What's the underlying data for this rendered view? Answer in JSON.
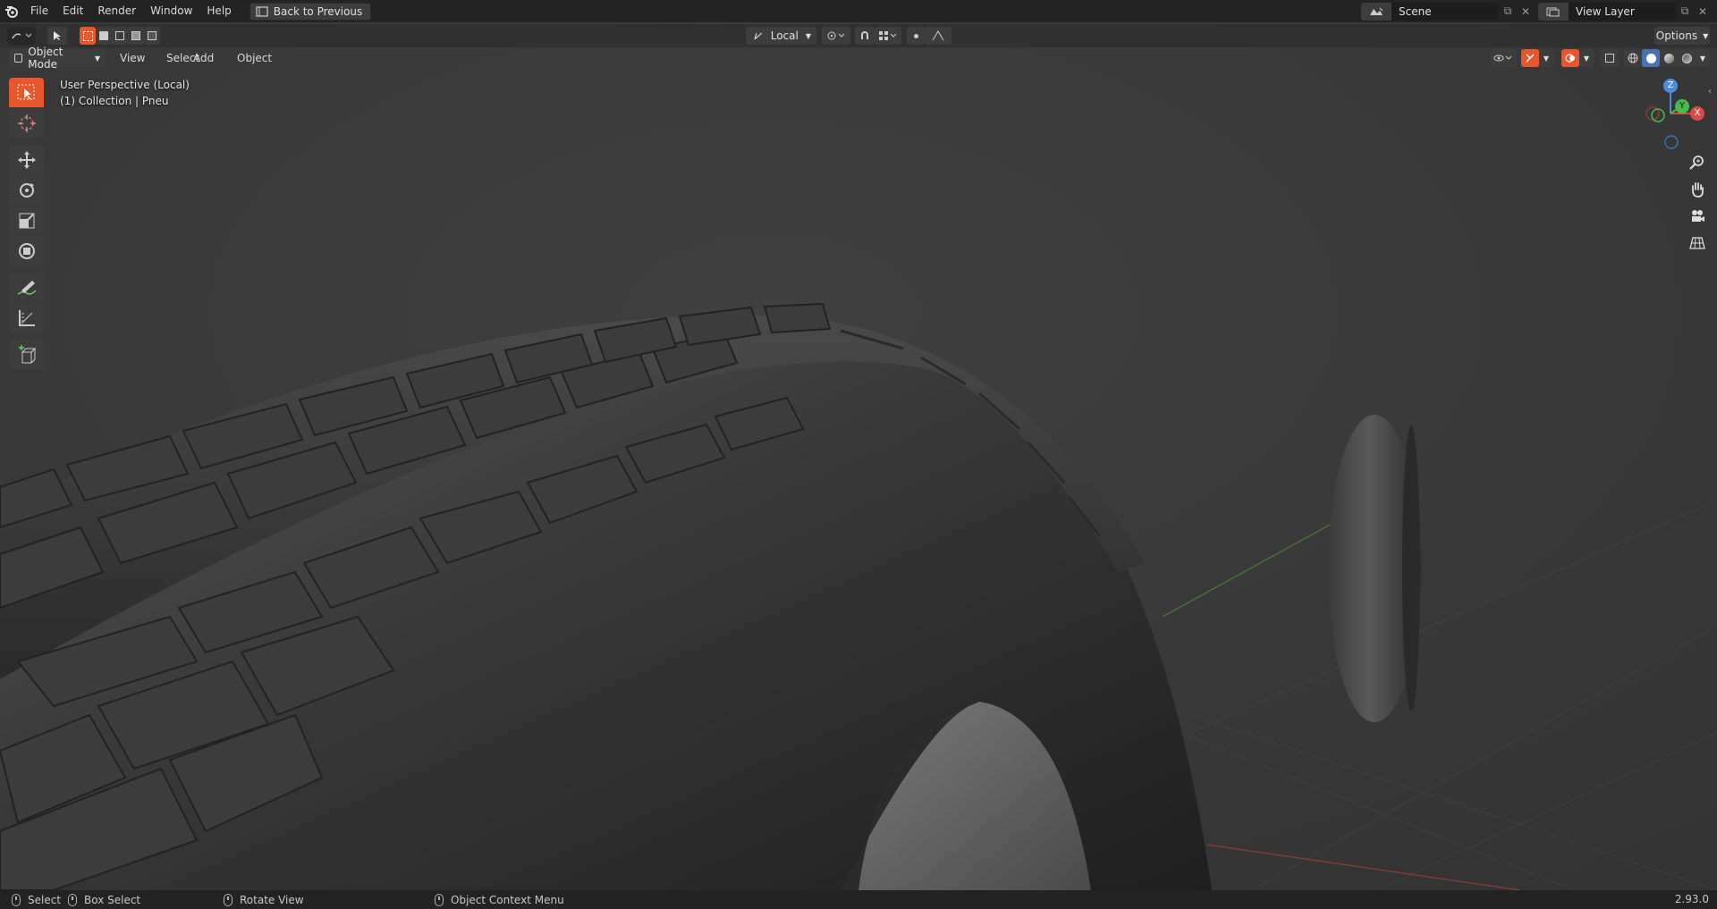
{
  "topbar": {
    "menus": [
      "File",
      "Edit",
      "Render",
      "Window",
      "Help"
    ],
    "back_button": "Back to Previous",
    "scene_name": "Scene",
    "view_layer_name": "View Layer"
  },
  "toolheader": {
    "transform_orientation": "Local",
    "options_label": "Options"
  },
  "viewheader": {
    "mode": "Object Mode",
    "menus": [
      "View",
      "Select",
      "Add",
      "Object"
    ]
  },
  "viewport": {
    "perspective": "User Perspective (Local)",
    "collection_info": "(1) Collection | Pneu"
  },
  "gizmo": {
    "z_label": "Z",
    "x_label": "X",
    "y_label": "Y"
  },
  "statusbar": {
    "select": "Select",
    "box_select": "Box Select",
    "rotate_view": "Rotate View",
    "context_menu": "Object Context Menu",
    "version": "2.93.0"
  },
  "colors": {
    "accent_active": "#e6572d",
    "header_bg": "#232323",
    "viewport_bg": "#393939"
  }
}
